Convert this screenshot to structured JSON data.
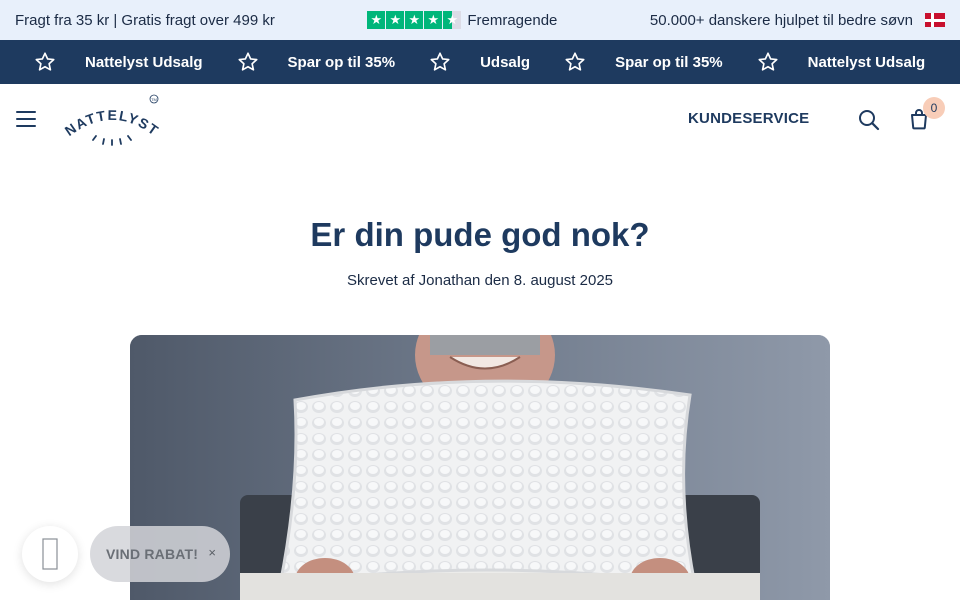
{
  "topbar": {
    "shipping": "Fragt fra 35 kr | Gratis fragt over 499 kr",
    "trustpilot_label": "Fremragende",
    "trustpilot_stars": 4.5,
    "trust_color": "#00b67a",
    "customers": "50.000+ danskere hjulpet til bedre søvn"
  },
  "ticker": {
    "items": [
      "Nattelyst Udsalg",
      "Spar op til 35%",
      "Udsalg",
      "Spar op til 35%",
      "Nattelyst Udsalg"
    ],
    "background": "#1e3a5f"
  },
  "header": {
    "logo_text": "NATTELYST",
    "logo_tm": "TM",
    "nav_kundeservice": "KUNDESERVICE",
    "cart_count": "0"
  },
  "article": {
    "title": "Er din pude god nok?",
    "byline": "Skrevet af Jonathan den 8. august 2025"
  },
  "discount": {
    "label": "VIND RABAT!",
    "close": "×"
  }
}
